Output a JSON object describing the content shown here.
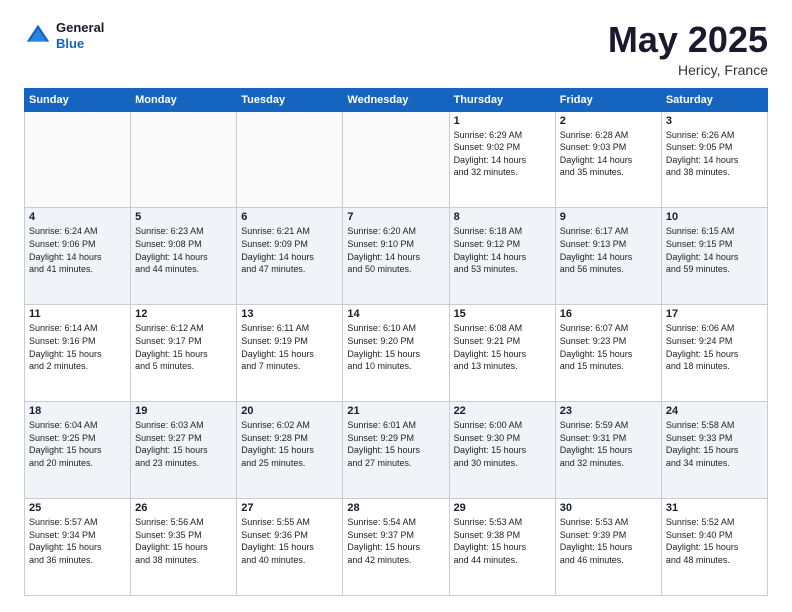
{
  "logo": {
    "line1": "General",
    "line2": "Blue"
  },
  "title": "May 2025",
  "location": "Hericy, France",
  "days_header": [
    "Sunday",
    "Monday",
    "Tuesday",
    "Wednesday",
    "Thursday",
    "Friday",
    "Saturday"
  ],
  "weeks": [
    [
      {
        "day": "",
        "info": ""
      },
      {
        "day": "",
        "info": ""
      },
      {
        "day": "",
        "info": ""
      },
      {
        "day": "",
        "info": ""
      },
      {
        "day": "1",
        "info": "Sunrise: 6:29 AM\nSunset: 9:02 PM\nDaylight: 14 hours\nand 32 minutes."
      },
      {
        "day": "2",
        "info": "Sunrise: 6:28 AM\nSunset: 9:03 PM\nDaylight: 14 hours\nand 35 minutes."
      },
      {
        "day": "3",
        "info": "Sunrise: 6:26 AM\nSunset: 9:05 PM\nDaylight: 14 hours\nand 38 minutes."
      }
    ],
    [
      {
        "day": "4",
        "info": "Sunrise: 6:24 AM\nSunset: 9:06 PM\nDaylight: 14 hours\nand 41 minutes."
      },
      {
        "day": "5",
        "info": "Sunrise: 6:23 AM\nSunset: 9:08 PM\nDaylight: 14 hours\nand 44 minutes."
      },
      {
        "day": "6",
        "info": "Sunrise: 6:21 AM\nSunset: 9:09 PM\nDaylight: 14 hours\nand 47 minutes."
      },
      {
        "day": "7",
        "info": "Sunrise: 6:20 AM\nSunset: 9:10 PM\nDaylight: 14 hours\nand 50 minutes."
      },
      {
        "day": "8",
        "info": "Sunrise: 6:18 AM\nSunset: 9:12 PM\nDaylight: 14 hours\nand 53 minutes."
      },
      {
        "day": "9",
        "info": "Sunrise: 6:17 AM\nSunset: 9:13 PM\nDaylight: 14 hours\nand 56 minutes."
      },
      {
        "day": "10",
        "info": "Sunrise: 6:15 AM\nSunset: 9:15 PM\nDaylight: 14 hours\nand 59 minutes."
      }
    ],
    [
      {
        "day": "11",
        "info": "Sunrise: 6:14 AM\nSunset: 9:16 PM\nDaylight: 15 hours\nand 2 minutes."
      },
      {
        "day": "12",
        "info": "Sunrise: 6:12 AM\nSunset: 9:17 PM\nDaylight: 15 hours\nand 5 minutes."
      },
      {
        "day": "13",
        "info": "Sunrise: 6:11 AM\nSunset: 9:19 PM\nDaylight: 15 hours\nand 7 minutes."
      },
      {
        "day": "14",
        "info": "Sunrise: 6:10 AM\nSunset: 9:20 PM\nDaylight: 15 hours\nand 10 minutes."
      },
      {
        "day": "15",
        "info": "Sunrise: 6:08 AM\nSunset: 9:21 PM\nDaylight: 15 hours\nand 13 minutes."
      },
      {
        "day": "16",
        "info": "Sunrise: 6:07 AM\nSunset: 9:23 PM\nDaylight: 15 hours\nand 15 minutes."
      },
      {
        "day": "17",
        "info": "Sunrise: 6:06 AM\nSunset: 9:24 PM\nDaylight: 15 hours\nand 18 minutes."
      }
    ],
    [
      {
        "day": "18",
        "info": "Sunrise: 6:04 AM\nSunset: 9:25 PM\nDaylight: 15 hours\nand 20 minutes."
      },
      {
        "day": "19",
        "info": "Sunrise: 6:03 AM\nSunset: 9:27 PM\nDaylight: 15 hours\nand 23 minutes."
      },
      {
        "day": "20",
        "info": "Sunrise: 6:02 AM\nSunset: 9:28 PM\nDaylight: 15 hours\nand 25 minutes."
      },
      {
        "day": "21",
        "info": "Sunrise: 6:01 AM\nSunset: 9:29 PM\nDaylight: 15 hours\nand 27 minutes."
      },
      {
        "day": "22",
        "info": "Sunrise: 6:00 AM\nSunset: 9:30 PM\nDaylight: 15 hours\nand 30 minutes."
      },
      {
        "day": "23",
        "info": "Sunrise: 5:59 AM\nSunset: 9:31 PM\nDaylight: 15 hours\nand 32 minutes."
      },
      {
        "day": "24",
        "info": "Sunrise: 5:58 AM\nSunset: 9:33 PM\nDaylight: 15 hours\nand 34 minutes."
      }
    ],
    [
      {
        "day": "25",
        "info": "Sunrise: 5:57 AM\nSunset: 9:34 PM\nDaylight: 15 hours\nand 36 minutes."
      },
      {
        "day": "26",
        "info": "Sunrise: 5:56 AM\nSunset: 9:35 PM\nDaylight: 15 hours\nand 38 minutes."
      },
      {
        "day": "27",
        "info": "Sunrise: 5:55 AM\nSunset: 9:36 PM\nDaylight: 15 hours\nand 40 minutes."
      },
      {
        "day": "28",
        "info": "Sunrise: 5:54 AM\nSunset: 9:37 PM\nDaylight: 15 hours\nand 42 minutes."
      },
      {
        "day": "29",
        "info": "Sunrise: 5:53 AM\nSunset: 9:38 PM\nDaylight: 15 hours\nand 44 minutes."
      },
      {
        "day": "30",
        "info": "Sunrise: 5:53 AM\nSunset: 9:39 PM\nDaylight: 15 hours\nand 46 minutes."
      },
      {
        "day": "31",
        "info": "Sunrise: 5:52 AM\nSunset: 9:40 PM\nDaylight: 15 hours\nand 48 minutes."
      }
    ]
  ]
}
